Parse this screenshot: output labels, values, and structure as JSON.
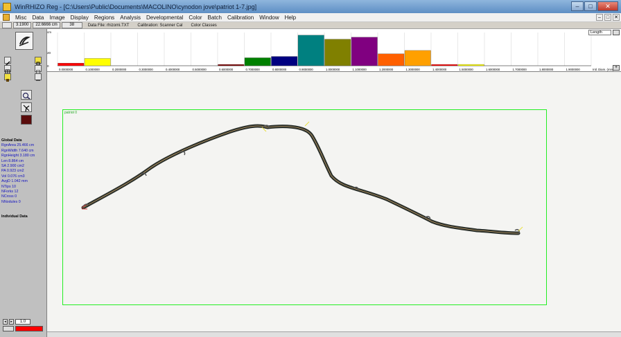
{
  "window": {
    "title": "WinRHIZO Reg - [C:\\Users\\Public\\Documents\\MACOLINO\\cynodon jove\\patriot 1-7.jpg]",
    "controls": [
      "–",
      "□",
      "✕"
    ]
  },
  "menu": {
    "items": [
      "Misc",
      "Data",
      "Image",
      "Display",
      "Regions",
      "Analysis",
      "Developmental",
      "Color",
      "Batch",
      "Calibration",
      "Window",
      "Help"
    ],
    "mdi_controls": [
      "–",
      "□",
      "✕"
    ]
  },
  "statusbar": {
    "field1": "3.1900",
    "field2": "22.6666 cm",
    "field3": "38",
    "data_file": "Data File: rhizomi.TXT",
    "calibration": "Calibration: Scanner Cal",
    "color_classes": "Color Classes"
  },
  "chart_data": {
    "type": "bar",
    "ylabel": "cm",
    "yticks": [
      "20",
      "0"
    ],
    "ylim": [
      0,
      50
    ],
    "categories": [
      "0.0000000",
      "0.1000000",
      "0.2000000",
      "0.3000000",
      "0.4000000",
      "0.5000000",
      "0.6000000",
      "0.7000000",
      "0.8000000",
      "0.9000000",
      "1.0000000",
      "1.1000000",
      "1.2000000",
      "1.3000000",
      "1.4000000",
      "1.5000000",
      "1.6000000",
      "1.7000000",
      "1.8000000",
      "1.9000000"
    ],
    "values": [
      4,
      11,
      0,
      0,
      0,
      0,
      2,
      12,
      14,
      46,
      40,
      43,
      18,
      23,
      2,
      2,
      0,
      0,
      0,
      0
    ],
    "colors": [
      "#ff0000",
      "#ffff00",
      "#ffffff",
      "#ffffff",
      "#ffffff",
      "#ffffff",
      "#800000",
      "#008000",
      "#000080",
      "#008080",
      "#808000",
      "#800080",
      "#ff6000",
      "#ffa000",
      "#ff0000",
      "#ffff00",
      "#ffffff",
      "#ffffff",
      "#ffffff",
      "#ffffff"
    ],
    "tail_label": "Intl. Diam. (mm)",
    "side_dropdown": "Length"
  },
  "global": {
    "header": "Global Data",
    "lines": [
      "RgnArea 25.466 cm",
      "RgnWidth 7.640 cm",
      "RgnHeight 3.180 cm",
      "Len 8.864 cm",
      "SA 2.900 cm2",
      "PA 0.923 cm2",
      "Vol 0.076 cm3",
      "AvgD 1.042 mm",
      "NTips 10",
      "NForks 12",
      "NCross 0",
      "NNodules 0"
    ],
    "individual_header": "Individual Data"
  },
  "leftpanel": {
    "zoom_value": "1.0"
  },
  "roi": {
    "label": "patriot 0"
  }
}
